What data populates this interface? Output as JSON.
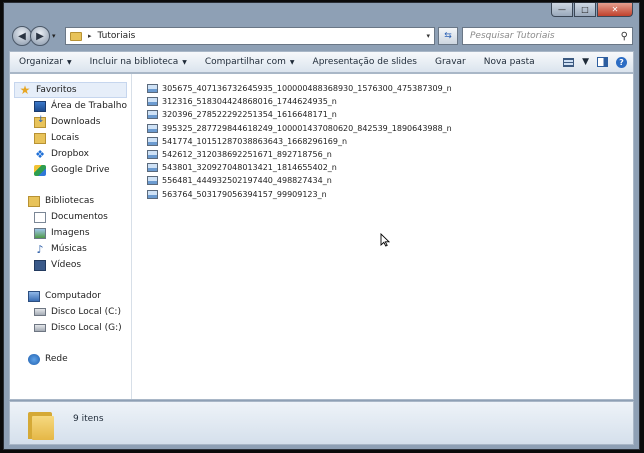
{
  "caption": {
    "minimize": "—",
    "maximize": "□",
    "close": "✕"
  },
  "address": {
    "path": "Tutoriais",
    "separator": "▸",
    "dropdown": "▾",
    "refresh": "⇆"
  },
  "search": {
    "placeholder": "Pesquisar Tutoriais"
  },
  "toolbar": {
    "organizar": "Organizar",
    "incluir": "Incluir na biblioteca",
    "compartilhar": "Compartilhar com",
    "apresentacao": "Apresentação de slides",
    "gravar": "Gravar",
    "nova_pasta": "Nova pasta",
    "arrow": "▼"
  },
  "nav": {
    "favoritos": "Favoritos",
    "area_de_trabalho": "Área de Trabalho",
    "downloads": "Downloads",
    "locais": "Locais",
    "dropbox": "Dropbox",
    "google_drive": "Google Drive",
    "bibliotecas": "Bibliotecas",
    "documentos": "Documentos",
    "imagens": "Imagens",
    "musicas": "Músicas",
    "videos": "Vídeos",
    "computador": "Computador",
    "disco_c": "Disco Local (C:)",
    "disco_g": "Disco Local (G:)",
    "rede": "Rede"
  },
  "files": [
    "305675_407136732645935_100000488368930_1576300_475387309_n",
    "312316_518304424868016_1744624935_n",
    "320396_278522292251354_1616648171_n",
    "395325_287729844618249_100001437080620_842539_1890643988_n",
    "541774_10151287038863643_1668296169_n",
    "542612_312038692251671_892718756_n",
    "543801_320927048013421_1814655402_n",
    "556481_444932502197440_498827434_n",
    "563764_503179056394157_99909123_n"
  ],
  "status": {
    "count": "9 itens"
  }
}
